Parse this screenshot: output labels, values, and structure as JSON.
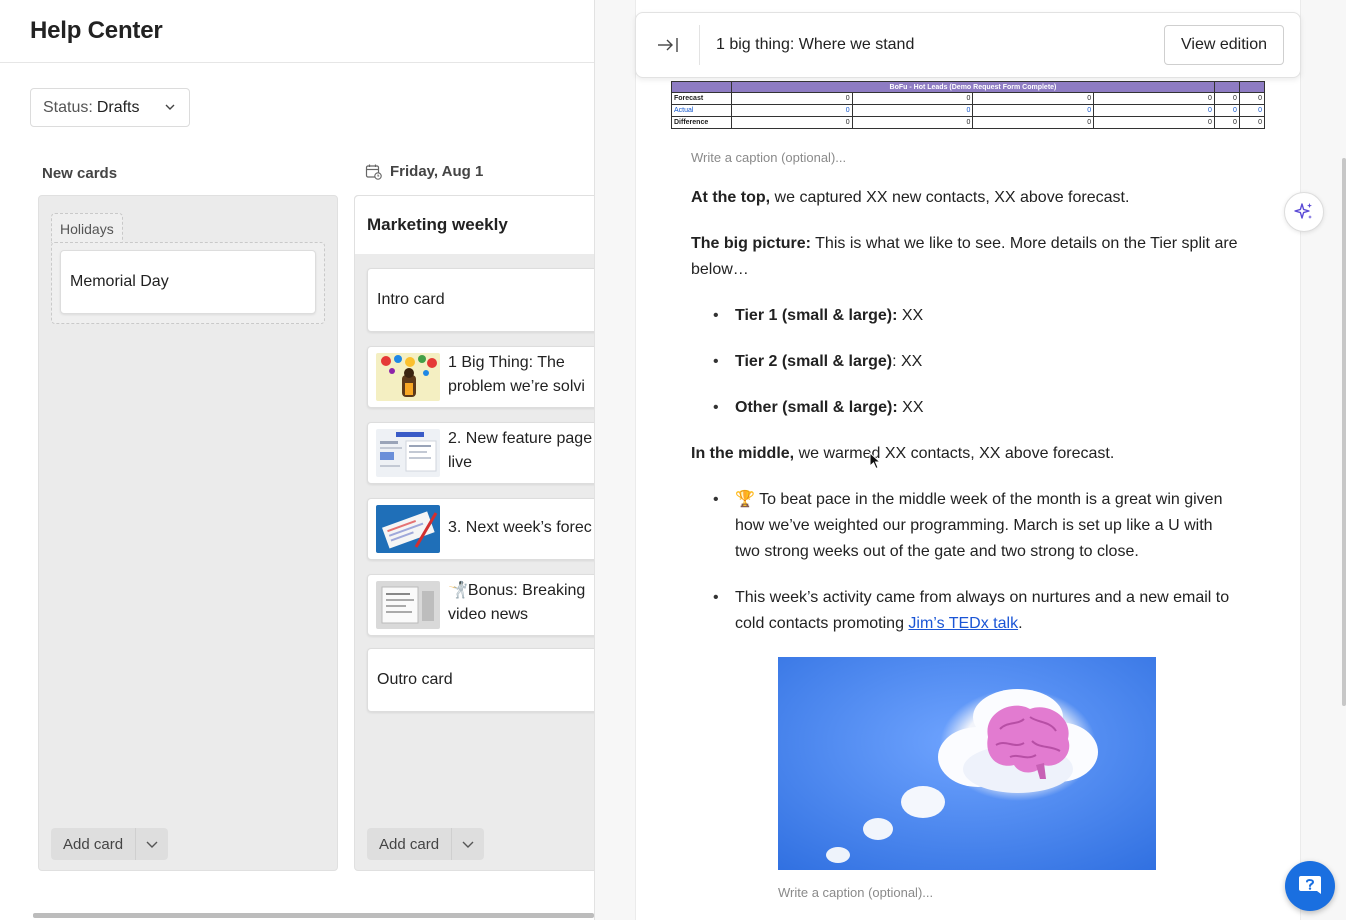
{
  "app": {
    "title": "Help Center"
  },
  "filter": {
    "label": "Status:",
    "value": "Drafts"
  },
  "columns": [
    {
      "title": "New cards",
      "group": {
        "label": "Holidays",
        "cards": [
          {
            "title": "Memorial Day"
          }
        ]
      },
      "add_label": "Add card"
    },
    {
      "title": "Friday, Aug 1",
      "edition": "Marketing weekly",
      "cards": [
        {
          "title": "Intro card"
        },
        {
          "line1": "1 Big Thing: The",
          "line2": "problem we’re solvi"
        },
        {
          "line1": "2. New feature page",
          "line2": "live"
        },
        {
          "line1": "3. Next week’s forec",
          "line2": ""
        },
        {
          "line1": "🤺Bonus: Breaking",
          "line2": "video news"
        },
        {
          "title": "Outro card"
        }
      ],
      "add_label": "Add card"
    }
  ],
  "drawer": {
    "title": "1 big thing: Where we stand",
    "view_button": "View edition",
    "sheet": {
      "header": "BoFu - Hot Leads (Demo Request Form Complete)",
      "rows": [
        {
          "label": "Forecast",
          "values": [
            "0",
            "0",
            "0",
            "0",
            "0",
            "0"
          ]
        },
        {
          "label": "Actual",
          "values": [
            "0",
            "0",
            "0",
            "0",
            "0",
            "0"
          ]
        },
        {
          "label": "Difference",
          "values": [
            "0",
            "0",
            "0",
            "0",
            "0",
            "0"
          ]
        }
      ]
    },
    "caption_placeholder": "Write a caption (optional)...",
    "p1_bold": "At the top,",
    "p1_text": " we captured XX new contacts, XX above forecast.",
    "p2_bold": "The big picture:",
    "p2_text": " This is what we like to see. More details on the Tier split are below…",
    "tiers": [
      {
        "bold": "Tier 1 (small & large):",
        "text": " XX"
      },
      {
        "bold": "Tier 2 (small & large)",
        "text": ": XX"
      },
      {
        "bold": "Other (small & large):",
        "text": " XX"
      }
    ],
    "p3_bold": "In the middle,",
    "p3_text": " we warmed XX contacts, XX above forecast.",
    "bullet_a": "🏆 To beat pace in the middle week of the month is a great win given how we’ve weighted our programming. March is set up like a U with two strong weeks out of the gate and two strong to close.",
    "bullet_b_text": "This week’s activity came from always on nurtures and a new email to cold contacts promoting ",
    "bullet_b_link": "Jim’s TEDx talk",
    "bullet_b_end": ".",
    "image_caption_placeholder": "Write a caption (optional)..."
  },
  "colors": {
    "accent": "#1a6fe0",
    "link": "#1a55d6",
    "sheet_header": "#8e7cc3",
    "sky": "#3d7ce0",
    "brain": "#e27bd0"
  },
  "icons": [
    "chevron-down-icon",
    "calendar-icon",
    "collapse-panel-icon",
    "sparkle-icon",
    "help-chat-icon"
  ]
}
